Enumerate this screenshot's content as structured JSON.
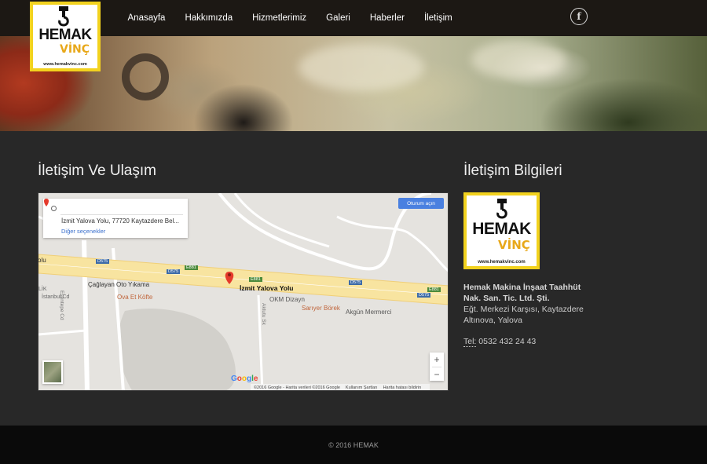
{
  "logo": {
    "brand": "HEMAK",
    "sub": "VİNÇ",
    "url": "www.hemakvinc.com"
  },
  "nav": [
    "Anasayfa",
    "Hakkımızda",
    "Hizmetlerimiz",
    "Galeri",
    "Haberler",
    "İletişim"
  ],
  "social": {
    "facebook": "f"
  },
  "main": {
    "title": "İletişim Ve Ulaşım"
  },
  "map": {
    "origin_placeholder": "",
    "destination": "İzmit Yalova Yolu, 77720 Kaytazdere Bel...",
    "more_options": "Diğer seçenekler",
    "signin": "Oturum açın",
    "pin_label": "İzmit Yalova Yolu",
    "places": {
      "car_wash": "Çağlayan Oto Yıkama",
      "kofte": "Ova Et Köfte",
      "okm": "OKM Dizayn",
      "borek": "Sarıyer Börek",
      "mermer": "Akgün Mermerci",
      "istanbul_cd": "İstanbul Cd",
      "esentepe_cd": "Esentepe Cd",
      "lik": "LİK",
      "yolu_left": "olu",
      "sk": "Aktutu Sk"
    },
    "road_badges": [
      "D575",
      "D575",
      "E881",
      "D575",
      "E881",
      "D575",
      "E881"
    ],
    "zoom_in": "+",
    "zoom_out": "−",
    "google": [
      "G",
      "o",
      "o",
      "g",
      "l",
      "e"
    ],
    "attribution": [
      "©2016 Google - Harita verileri ©2016 Google",
      "Kullanım Şartları",
      "Harita hatası bildirin"
    ]
  },
  "sidebar": {
    "title": "İletişim Bilgileri",
    "company_line1": "Hemak Makina İnşaat Taahhüt",
    "company_line2": "Nak. San. Tic. Ltd. Şti.",
    "address_line1": "Eğt. Merkezi Karşısı, Kaytazdere",
    "address_line2": "Altınova, Yalova",
    "phone_label": "Tel:",
    "phone": "0532 432 24 43"
  },
  "footer": {
    "copyright": "© 2016 HEMAK"
  },
  "colors": {
    "header": "#1c1814",
    "body": "#282828",
    "footer": "#0a0a0a",
    "logo_yellow": "#f2d21e",
    "road": "#f8e4a0"
  }
}
